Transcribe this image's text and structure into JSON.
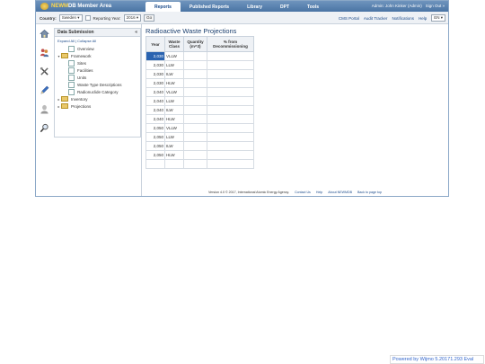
{
  "app": {
    "logo_prefix": "NEWM",
    "logo_suffix": "DB Member Area"
  },
  "nav": {
    "tabs": [
      {
        "label": "Reports",
        "active": true
      },
      {
        "label": "Published Reports",
        "active": false
      },
      {
        "label": "Library",
        "active": false
      },
      {
        "label": "DPT",
        "active": false
      },
      {
        "label": "Tools",
        "active": false
      }
    ]
  },
  "user_links": {
    "admin": "Admin: John Kinker (Admin)",
    "signout": "Sign Out »"
  },
  "filter": {
    "country_label": "Country:",
    "country_value": "Sweden",
    "year_label": "Reporting Year:",
    "year_value": "2016",
    "go_label": "Go"
  },
  "right_links": {
    "items": [
      "CMS Portal",
      "Audit Tracker",
      "Notifications",
      "Help"
    ],
    "lang": "EN"
  },
  "tree": {
    "title": "Data Submission",
    "collapse_icon": "«",
    "expand_all": "Expand All | Collapse All",
    "items": [
      {
        "label": "Overview",
        "level": 1,
        "type": "doc",
        "toggle": ""
      },
      {
        "label": "Framework",
        "level": 0,
        "type": "folder",
        "toggle": "▾"
      },
      {
        "label": "Sites",
        "level": 1,
        "type": "doc",
        "toggle": ""
      },
      {
        "label": "Facilities",
        "level": 1,
        "type": "doc",
        "toggle": ""
      },
      {
        "label": "Units",
        "level": 1,
        "type": "doc",
        "toggle": ""
      },
      {
        "label": "Waste Type Descriptions",
        "level": 1,
        "type": "doc",
        "toggle": ""
      },
      {
        "label": "Radionuclide Category",
        "level": 1,
        "type": "doc",
        "toggle": ""
      },
      {
        "label": "Inventory",
        "level": 0,
        "type": "folder",
        "toggle": "▸"
      },
      {
        "label": "Projections",
        "level": 0,
        "type": "folder",
        "toggle": "▸"
      }
    ]
  },
  "icons": [
    "home-icon",
    "users-icon",
    "tools-icon",
    "pencil-icon",
    "person-icon",
    "magnifier-icon"
  ],
  "main": {
    "title": "Radioactive Waste Projections",
    "columns": [
      "Year",
      "Waste Class",
      "Quantity (m^3)",
      "% from Decommissioning"
    ],
    "rows": [
      {
        "year": "2,030",
        "waste": "VLLW",
        "selected": true
      },
      {
        "year": "2,030",
        "waste": "LLW",
        "selected": false
      },
      {
        "year": "2,030",
        "waste": "ILW",
        "selected": false
      },
      {
        "year": "2,030",
        "waste": "HLW",
        "selected": false
      },
      {
        "year": "2,040",
        "waste": "VLLW",
        "selected": false
      },
      {
        "year": "2,040",
        "waste": "LLW",
        "selected": false
      },
      {
        "year": "2,040",
        "waste": "ILW",
        "selected": false
      },
      {
        "year": "2,040",
        "waste": "HLW",
        "selected": false
      },
      {
        "year": "2,050",
        "waste": "VLLW",
        "selected": false
      },
      {
        "year": "2,050",
        "waste": "LLW",
        "selected": false
      },
      {
        "year": "2,050",
        "waste": "ILW",
        "selected": false
      },
      {
        "year": "2,050",
        "waste": "HLW",
        "selected": false
      },
      {
        "year": "",
        "waste": "",
        "selected": false
      }
    ]
  },
  "footer": {
    "version": "Version 4.0 © 2017, International Atomic Energy Agency.",
    "links": [
      "Contact Us",
      "Help",
      "About NEWMDB",
      "Back to page top"
    ]
  },
  "wijmo": "Powered by Wijmo 5.20171.293 Eval"
}
